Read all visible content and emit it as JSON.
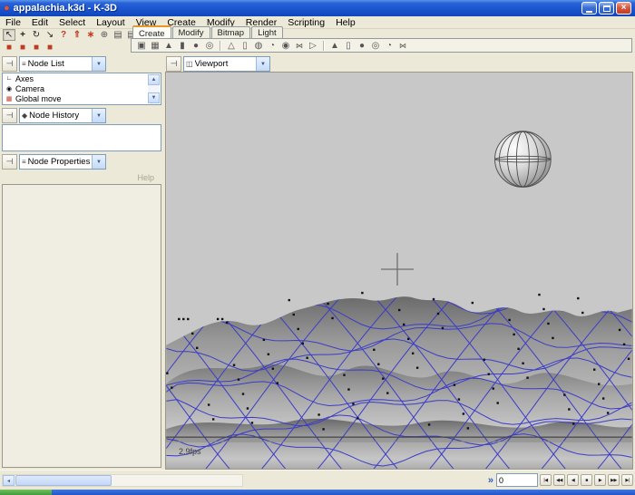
{
  "window": {
    "title": "appalachia.k3d - K-3D",
    "close_glyph": "×"
  },
  "menubar": {
    "items": [
      "File",
      "Edit",
      "Select",
      "Layout",
      "View",
      "Create",
      "Modify",
      "Render",
      "Scripting",
      "Help"
    ]
  },
  "tool_tabs": {
    "tabs": [
      "Create",
      "Modify",
      "Bitmap",
      "Light"
    ],
    "active": "Create"
  },
  "icons": {
    "app": "●",
    "pin": "⊣",
    "combo_arrow": "▼",
    "select_tool": "↖",
    "move_tool": "+",
    "rotate_tool": "↻",
    "scale_tool": "↘",
    "context_help_tool": "?",
    "parent_tool": "⇑",
    "snap_tool": "∗",
    "add_tool": "⊕",
    "render_preview": "▤",
    "render_frame": "▤",
    "select_nodes": "■",
    "select_points": "■",
    "select_lines": "■",
    "select_faces": "■",
    "node_list": "≡",
    "node_history": "◆",
    "node_properties": "≡",
    "viewport": "◫",
    "axes": "∟",
    "camera": "◉",
    "global_move": "▦",
    "scroll_up": "▲",
    "scroll_down": "▼",
    "scroll_left": "◂",
    "frame_toggle": "»"
  },
  "create_toolbar": {
    "primitives": [
      {
        "name": "poly-cube",
        "glyph": "▣"
      },
      {
        "name": "poly-grid",
        "glyph": "▦"
      },
      {
        "name": "poly-cone",
        "glyph": "▲"
      },
      {
        "name": "poly-cylinder",
        "glyph": "▮"
      },
      {
        "name": "poly-sphere",
        "glyph": "●"
      },
      {
        "name": "poly-torus",
        "glyph": "◎"
      },
      {
        "name": "quadric-cone",
        "glyph": "△"
      },
      {
        "name": "quadric-cylinder",
        "glyph": "▯"
      },
      {
        "name": "quadric-disk",
        "glyph": "◍"
      },
      {
        "name": "quadric-hyperboloid",
        "glyph": "◔"
      },
      {
        "name": "quadric-sphere",
        "glyph": "◉"
      },
      {
        "name": "quadric-bilinear",
        "glyph": "⋈"
      },
      {
        "name": "quadric-paraboloid",
        "glyph": "▷"
      },
      {
        "name": "nurbs-cone",
        "glyph": "▲"
      },
      {
        "name": "nurbs-cylinder",
        "glyph": "▯"
      },
      {
        "name": "nurbs-sphere",
        "glyph": "●"
      },
      {
        "name": "nurbs-torus",
        "glyph": "◎"
      },
      {
        "name": "nurbs-patch",
        "glyph": "◔"
      },
      {
        "name": "nurbs-polygon",
        "glyph": "⋈"
      }
    ]
  },
  "panels": {
    "node_list": {
      "title": "Node List",
      "items": [
        {
          "label": "Axes"
        },
        {
          "label": "Camera"
        },
        {
          "label": "Global move"
        }
      ]
    },
    "node_history": {
      "title": "Node History"
    },
    "node_properties": {
      "title": "Node Properties",
      "help_label": "Help"
    }
  },
  "viewport": {
    "title": "Viewport",
    "fps_label": "2.9fps"
  },
  "timeline": {
    "frame": "0",
    "buttons": [
      {
        "glyph": "|◀"
      },
      {
        "glyph": "◀◀"
      },
      {
        "glyph": "◀"
      },
      {
        "glyph": "■"
      },
      {
        "glyph": "▶"
      },
      {
        "glyph": "▶▶"
      },
      {
        "glyph": "▶|"
      }
    ]
  }
}
